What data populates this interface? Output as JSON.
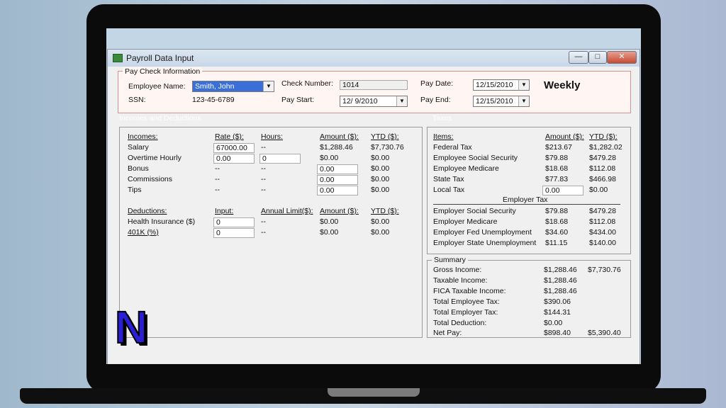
{
  "window": {
    "title": "Payroll Data Input",
    "minimize": "—",
    "maximize": "□",
    "close": "✕"
  },
  "paycheck": {
    "legend": "Pay Check Information",
    "employee_name_label": "Employee Name:",
    "employee_name_value": "Smith, John",
    "ssn_label": "SSN:",
    "ssn_value": "123-45-6789",
    "check_number_label": "Check Number:",
    "check_number_value": "1014",
    "pay_start_label": "Pay Start:",
    "pay_start_value": "12/ 9/2010",
    "pay_date_label": "Pay Date:",
    "pay_date_value": "12/15/2010",
    "pay_end_label": "Pay End:",
    "pay_end_value": "12/15/2010",
    "frequency": "Weekly"
  },
  "incomes_deductions": {
    "header": "Incomes and Deductions",
    "incomes": {
      "headers": [
        "Incomes:",
        "Rate ($):",
        "Hours:",
        "Amount ($):",
        "YTD ($):"
      ],
      "rows": [
        {
          "label": "Salary",
          "rate": "67000.00",
          "hours": "--",
          "amount": "$1,288.46",
          "ytd": "$7,730.76"
        },
        {
          "label": "Overtime Hourly",
          "rate": "0.00",
          "hours": "0",
          "amount": "$0.00",
          "ytd": "$0.00"
        },
        {
          "label": "Bonus",
          "rate": "--",
          "hours": "--",
          "amount": "0.00",
          "ytd": "$0.00"
        },
        {
          "label": "Commissions",
          "rate": "--",
          "hours": "--",
          "amount": "0.00",
          "ytd": "$0.00"
        },
        {
          "label": "Tips",
          "rate": "--",
          "hours": "--",
          "amount": "0.00",
          "ytd": "$0.00"
        }
      ]
    },
    "deductions": {
      "headers": [
        "Deductions:",
        "Input:",
        "Annual Limit($):",
        "Amount ($):",
        "YTD ($):"
      ],
      "rows": [
        {
          "label": "Health Insurance  ($)",
          "input": "0",
          "limit": "--",
          "amount": "$0.00",
          "ytd": "$0.00"
        },
        {
          "label": "401K  (%)",
          "input": "0",
          "limit": "--",
          "amount": "$0.00",
          "ytd": "$0.00"
        }
      ]
    }
  },
  "taxes": {
    "header": "Taxes",
    "headers": [
      "Items:",
      "Amount ($):",
      "YTD ($):"
    ],
    "employee_rows": [
      {
        "label": "Federal Tax",
        "amount": "$213.67",
        "ytd": "$1,282.02"
      },
      {
        "label": "Employee Social Security",
        "amount": "$79.88",
        "ytd": "$479.28"
      },
      {
        "label": "Employee Medicare",
        "amount": "$18.68",
        "ytd": "$112.08"
      },
      {
        "label": "State Tax",
        "amount": "$77.83",
        "ytd": "$466.98"
      },
      {
        "label": "Local Tax",
        "amount": "0.00",
        "ytd": "$0.00"
      }
    ],
    "employer_title": "Employer Tax",
    "employer_rows": [
      {
        "label": "Employer Social Security",
        "amount": "$79.88",
        "ytd": "$479.28"
      },
      {
        "label": "Employer Medicare",
        "amount": "$18.68",
        "ytd": "$112.08"
      },
      {
        "label": "Employer Fed Unemployment",
        "amount": "$34.60",
        "ytd": "$434.00"
      },
      {
        "label": "Employer State Unemployment",
        "amount": "$11.15",
        "ytd": "$140.00"
      }
    ]
  },
  "summary": {
    "legend": "Summary",
    "rows": [
      {
        "label": "Gross Income:",
        "amount": "$1,288.46",
        "ytd": "$7,730.76"
      },
      {
        "label": "Taxable Income:",
        "amount": "$1,288.46",
        "ytd": ""
      },
      {
        "label": "FICA Taxable Income:",
        "amount": "$1,288.46",
        "ytd": ""
      },
      {
        "label": "Total Employee Tax:",
        "amount": "$390.06",
        "ytd": ""
      },
      {
        "label": "Total Employer Tax:",
        "amount": "$144.31",
        "ytd": ""
      },
      {
        "label": "Total Deduction:",
        "amount": "$0.00",
        "ytd": ""
      },
      {
        "label": "Net Pay:",
        "amount": "$898.40",
        "ytd": "$5,390.40"
      }
    ]
  },
  "logo": {
    "letter": "N"
  }
}
